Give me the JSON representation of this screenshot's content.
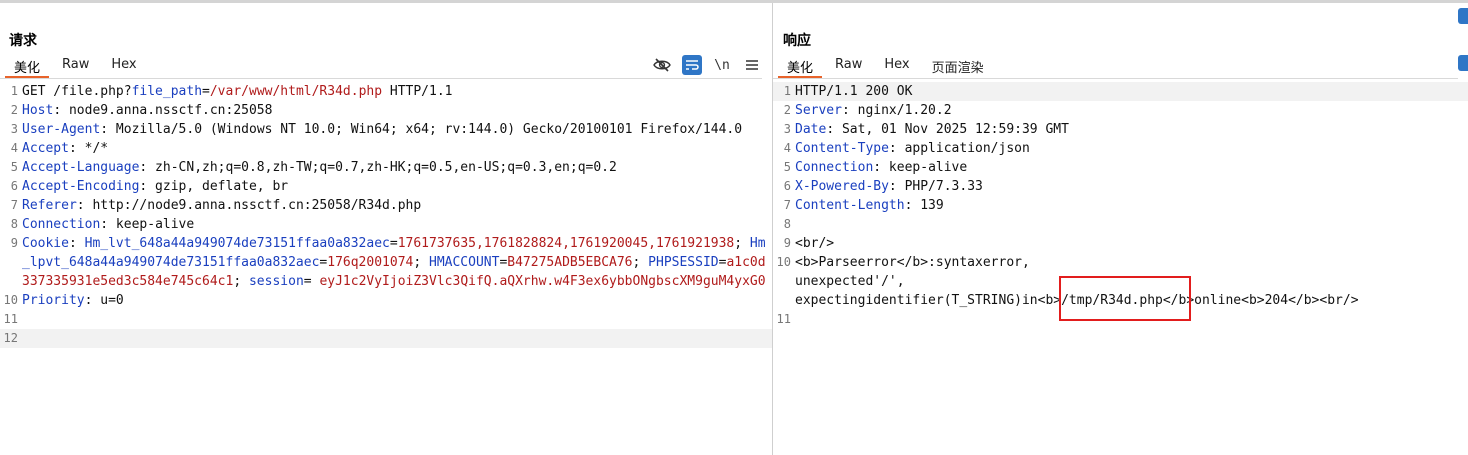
{
  "request": {
    "title": "请求",
    "tabs": [
      {
        "label": "美化",
        "active": true
      },
      {
        "label": "Raw",
        "active": false
      },
      {
        "label": "Hex",
        "active": false
      }
    ],
    "toolbar": {
      "hide_icon": "eye-slash-icon",
      "wrap_icon": "wrap-lines-icon",
      "newline_label": "\\n",
      "menu_icon": "hamburger-menu-icon"
    },
    "lines": [
      {
        "n": "1",
        "parts": [
          [
            "p",
            "GET /file.php?"
          ],
          [
            "k",
            "file_path"
          ],
          [
            "p",
            "="
          ],
          [
            "v",
            "/var/www/html/R34d.php"
          ],
          [
            "p",
            " HTTP/1.1"
          ]
        ]
      },
      {
        "n": "2",
        "parts": [
          [
            "k",
            "Host"
          ],
          [
            "p",
            ": node9.anna.nssctf.cn:25058"
          ]
        ]
      },
      {
        "n": "3",
        "parts": [
          [
            "k",
            "User-Agent"
          ],
          [
            "p",
            ": Mozilla/5.0 (Windows NT 10.0; Win64; x64; rv:144.0) Gecko/20100101 Firefox/144.0"
          ]
        ]
      },
      {
        "n": "4",
        "parts": [
          [
            "k",
            "Accept"
          ],
          [
            "p",
            ": */*"
          ]
        ]
      },
      {
        "n": "5",
        "parts": [
          [
            "k",
            "Accept-Language"
          ],
          [
            "p",
            ": zh-CN,zh;q=0.8,zh-TW;q=0.7,zh-HK;q=0.5,en-US;q=0.3,en;q=0.2"
          ]
        ]
      },
      {
        "n": "6",
        "parts": [
          [
            "k",
            "Accept-Encoding"
          ],
          [
            "p",
            ": gzip, deflate, br"
          ]
        ]
      },
      {
        "n": "7",
        "parts": [
          [
            "k",
            "Referer"
          ],
          [
            "p",
            ": http://node9.anna.nssctf.cn:25058/R34d.php"
          ]
        ]
      },
      {
        "n": "8",
        "parts": [
          [
            "k",
            "Connection"
          ],
          [
            "p",
            ": keep-alive"
          ]
        ]
      },
      {
        "n": "9",
        "parts": [
          [
            "k",
            "Cookie"
          ],
          [
            "p",
            ": "
          ],
          [
            "k",
            "Hm_lvt_648a44a949074de73151ffaa0a832aec"
          ],
          [
            "p",
            "="
          ],
          [
            "v",
            "1761737635,1761828824,1761920045,1761921938"
          ],
          [
            "p",
            "; "
          ],
          [
            "k",
            "Hm_lpvt_648a44a949074de73151ffaa0a832aec"
          ],
          [
            "p",
            "="
          ],
          [
            "v",
            "176q2001074"
          ],
          [
            "p",
            "; "
          ],
          [
            "k",
            "HMACCOUNT"
          ],
          [
            "p",
            "="
          ],
          [
            "v",
            "B47275ADB5EBCA76"
          ],
          [
            "p",
            "; "
          ],
          [
            "k",
            "PHPSESSID"
          ],
          [
            "p",
            "="
          ],
          [
            "v",
            "a1c0d337335931e5ed3c584e745c64c1"
          ],
          [
            "p",
            "; "
          ],
          [
            "k",
            "session"
          ],
          [
            "p",
            "= "
          ],
          [
            "v",
            "eyJ1c2VyIjoiZ3Vlc3QifQ.aQXrhw.w4F3ex6ybbONgbscXM9guM4yxG0"
          ]
        ]
      },
      {
        "n": "10",
        "parts": [
          [
            "k",
            "Priority"
          ],
          [
            "p",
            ": u=0"
          ]
        ]
      },
      {
        "n": "11",
        "parts": [
          [
            "p",
            ""
          ]
        ]
      },
      {
        "n": "12",
        "parts": [
          [
            "p",
            ""
          ]
        ],
        "highlight": true
      }
    ]
  },
  "response": {
    "title": "响应",
    "tabs": [
      {
        "label": "美化",
        "active": true
      },
      {
        "label": "Raw",
        "active": false
      },
      {
        "label": "Hex",
        "active": false
      },
      {
        "label": "页面渲染",
        "active": false
      }
    ],
    "lines": [
      {
        "n": "1",
        "parts": [
          [
            "p",
            "HTTP/1.1 200 OK"
          ]
        ],
        "highlight": true
      },
      {
        "n": "2",
        "parts": [
          [
            "k",
            "Server"
          ],
          [
            "p",
            ": nginx/1.20.2"
          ]
        ]
      },
      {
        "n": "3",
        "parts": [
          [
            "k",
            "Date"
          ],
          [
            "p",
            ": Sat, 01 Nov 2025 12:59:39 GMT"
          ]
        ]
      },
      {
        "n": "4",
        "parts": [
          [
            "k",
            "Content-Type"
          ],
          [
            "p",
            ": application/json"
          ]
        ]
      },
      {
        "n": "5",
        "parts": [
          [
            "k",
            "Connection"
          ],
          [
            "p",
            ": keep-alive"
          ]
        ]
      },
      {
        "n": "6",
        "parts": [
          [
            "k",
            "X-Powered-By"
          ],
          [
            "p",
            ": PHP/7.3.33"
          ]
        ]
      },
      {
        "n": "7",
        "parts": [
          [
            "k",
            "Content-Length"
          ],
          [
            "p",
            ": 139"
          ]
        ]
      },
      {
        "n": "8",
        "parts": [
          [
            "p",
            ""
          ]
        ]
      },
      {
        "n": "9",
        "parts": [
          [
            "p",
            "<br/>"
          ]
        ]
      },
      {
        "n": "10",
        "parts": [
          [
            "p",
            "<b>Parseerror</b>:syntaxerror,\nunexpected'/',\nexpectingidentifier(T_STRING)in<b>/tmp/R34d.php</b>online<b>204</b><br/>"
          ]
        ]
      },
      {
        "n": "11",
        "parts": [
          [
            "p",
            ""
          ]
        ]
      }
    ]
  },
  "colors": {
    "key": "#1a3fbf",
    "value": "#b01b1b",
    "accent": "#e8632b",
    "toolbar_active": "#2f76c6",
    "annotation_box": "#e21d1d"
  }
}
